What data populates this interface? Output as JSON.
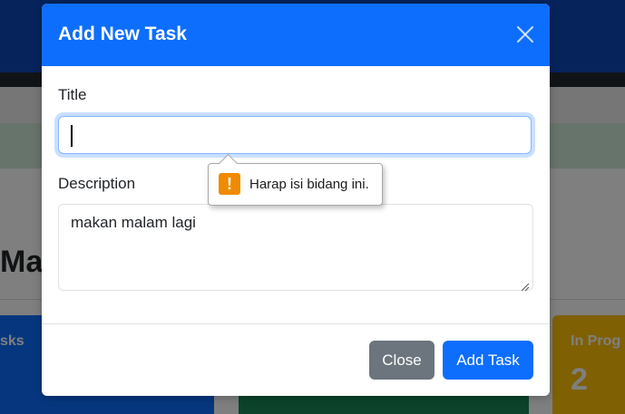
{
  "background": {
    "heading_fragment": "Ma",
    "cards": [
      {
        "label": "sks",
        "value": "",
        "color": "#0d6efd"
      },
      {
        "label": "",
        "value": "",
        "color": "#198754"
      },
      {
        "label": "In Prog",
        "value": "2",
        "color": "#ffc107"
      }
    ]
  },
  "modal": {
    "title": "Add New Task",
    "close_icon": "close-icon",
    "form": {
      "title_label": "Title",
      "title_value": "",
      "title_placeholder": "",
      "description_label": "Description",
      "description_value": "makan malam lagi"
    },
    "validation": {
      "message": "Harap isi bidang ini.",
      "icon": "warning-icon",
      "icon_glyph": "!"
    },
    "buttons": {
      "close_label": "Close",
      "add_label": "Add Task"
    }
  },
  "colors": {
    "primary": "#0d6efd",
    "secondary": "#6c757d",
    "warning_icon": "#f08a00"
  }
}
